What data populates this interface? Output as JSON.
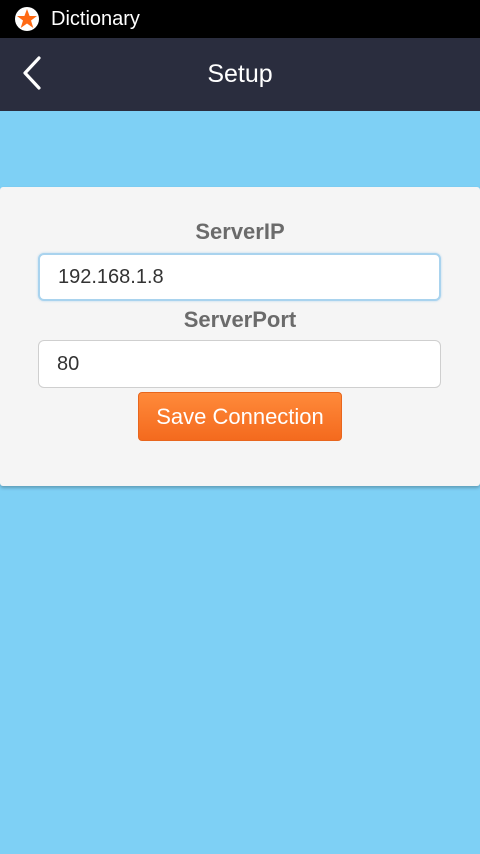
{
  "status_bar": {
    "app_icon": "star-icon",
    "title": "Dictionary",
    "icon_colors": {
      "star": "#ff6a14",
      "ring": "#ffffff"
    }
  },
  "action_bar": {
    "back_icon": "chevron-left-icon",
    "title": "Setup"
  },
  "form": {
    "server_ip_label": "ServerIP",
    "server_ip_value": "192.168.1.8",
    "server_port_label": "ServerPort",
    "server_port_value": "80",
    "save_label": "Save Connection"
  },
  "colors": {
    "background": "#7ed0f5",
    "action_bar": "#2a2d3e",
    "accent": "#f46a1e"
  }
}
